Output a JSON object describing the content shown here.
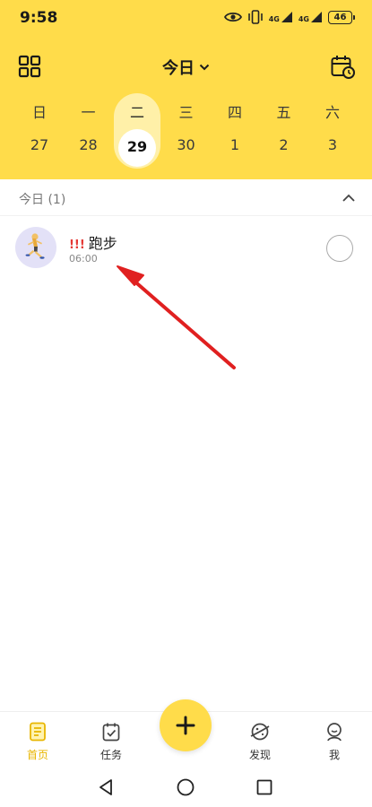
{
  "status_bar": {
    "time": "9:58",
    "network_1": "4G",
    "network_2": "4G",
    "battery": "46"
  },
  "header": {
    "title": "今日",
    "grid_icon": "grid-icon",
    "calendar_icon": "calendar-clock-icon"
  },
  "week": {
    "days": [
      {
        "weekday": "日",
        "date": "27"
      },
      {
        "weekday": "一",
        "date": "28"
      },
      {
        "weekday": "二",
        "date": "29"
      },
      {
        "weekday": "三",
        "date": "30"
      },
      {
        "weekday": "四",
        "date": "1"
      },
      {
        "weekday": "五",
        "date": "2"
      },
      {
        "weekday": "六",
        "date": "3"
      }
    ],
    "selected_index": 2
  },
  "section": {
    "title": "今日 (1)"
  },
  "tasks": [
    {
      "priority": "!!!",
      "name": "跑步",
      "time": "06:00",
      "avatar_icon": "runner-icon"
    }
  ],
  "tabbar": {
    "items": [
      {
        "label": "首页",
        "icon": "home-notes-icon"
      },
      {
        "label": "任务",
        "icon": "task-calendar-icon"
      },
      {
        "label": "发现",
        "icon": "discover-planet-icon"
      },
      {
        "label": "我",
        "icon": "profile-icon"
      }
    ],
    "add_icon": "plus-icon"
  },
  "colors": {
    "accent": "#FFDC4A",
    "accent_light": "#FFF0A8",
    "active_tab": "#E8B600",
    "priority": "#E53935",
    "arrow": "#E02020"
  }
}
